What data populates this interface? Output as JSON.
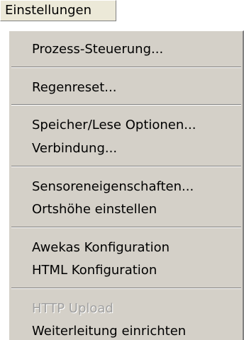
{
  "menubar": {
    "title": "Einstellungen"
  },
  "menu": {
    "items": [
      {
        "label": "Prozess-Steuerung...",
        "enabled": true
      },
      {
        "label": "Regenreset...",
        "enabled": true
      },
      {
        "label": "Speicher/Lese Optionen...",
        "enabled": true
      },
      {
        "label": "Verbindung...",
        "enabled": true
      },
      {
        "label": "Sensoreneigenschaften...",
        "enabled": true
      },
      {
        "label": "Ortshöhe einstellen",
        "enabled": true
      },
      {
        "label": "Awekas Konfiguration",
        "enabled": true
      },
      {
        "label": "HTML Konfiguration",
        "enabled": true
      },
      {
        "label": "HTTP Upload",
        "enabled": false
      },
      {
        "label": "Weiterleitung einrichten",
        "enabled": true
      }
    ]
  }
}
